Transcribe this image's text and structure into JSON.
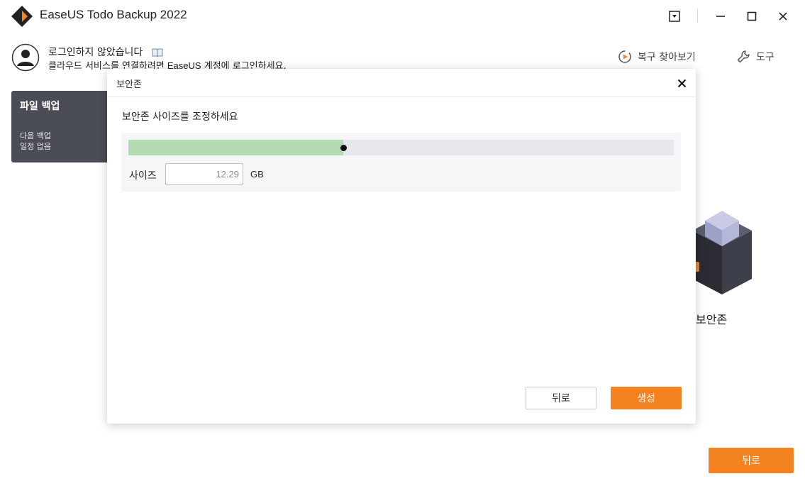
{
  "app": {
    "title": "EaseUS Todo Backup 2022"
  },
  "titlebar": {
    "icons": [
      "dropdown-icon",
      "minimize-icon",
      "maximize-icon",
      "close-icon"
    ]
  },
  "account": {
    "title": "로그인하지 않았습니다",
    "subtitle_pre": "클라우드 서비스를 연결하려면 ",
    "subtitle_brand": "EaseUS",
    "subtitle_post": " 계정에 로그인하세요."
  },
  "header_links": {
    "restore": "복구 찾아보기",
    "tools": "도구"
  },
  "file_backup_card": {
    "title": "파일 백업",
    "line1": "다음 백업",
    "line2": "일정 없음"
  },
  "zone_tile": {
    "label": "보안존"
  },
  "bottom": {
    "back_label": "뒤로"
  },
  "dialog": {
    "title": "보안존",
    "instruction": "보안존 사이즈를 조정하세요",
    "slider_fraction": 0.394,
    "size_label": "사이즈",
    "size_value": "12.29",
    "size_unit": "GB",
    "back_label": "뒤로",
    "create_label": "생성"
  },
  "colors": {
    "accent": "#f58220",
    "slider_fill": "#b5dbb5",
    "card_bg": "#4a4d55"
  }
}
